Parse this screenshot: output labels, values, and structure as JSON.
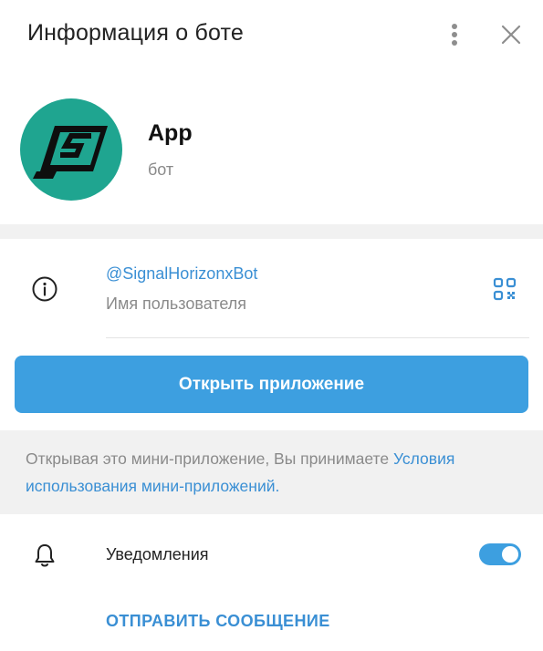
{
  "header": {
    "title": "Информация о боте",
    "more_icon": "more-vertical-icon",
    "close_icon": "close-icon"
  },
  "profile": {
    "name": "App",
    "status": "бот",
    "avatar_color": "#1fa590"
  },
  "info": {
    "username": "@SignalHorizonxBot",
    "username_label": "Имя пользователя",
    "info_icon": "info-icon",
    "qr_icon": "qr-code-icon"
  },
  "open_app": {
    "label": "Открыть приложение",
    "color": "#3d9fe0"
  },
  "terms": {
    "prefix": "Открывая это мини-приложение, Вы принимаете ",
    "link": "Условия использования мини-приложений",
    "suffix": "."
  },
  "notifications": {
    "label": "Уведомления",
    "enabled": true,
    "icon": "bell-icon"
  },
  "send_message": {
    "label": "ОТПРАВИТЬ СООБЩЕНИЕ"
  },
  "colors": {
    "accent": "#3d9fe0",
    "link": "#3a8fd4",
    "muted": "#8a8a8a",
    "separator": "#f1f1f1"
  }
}
